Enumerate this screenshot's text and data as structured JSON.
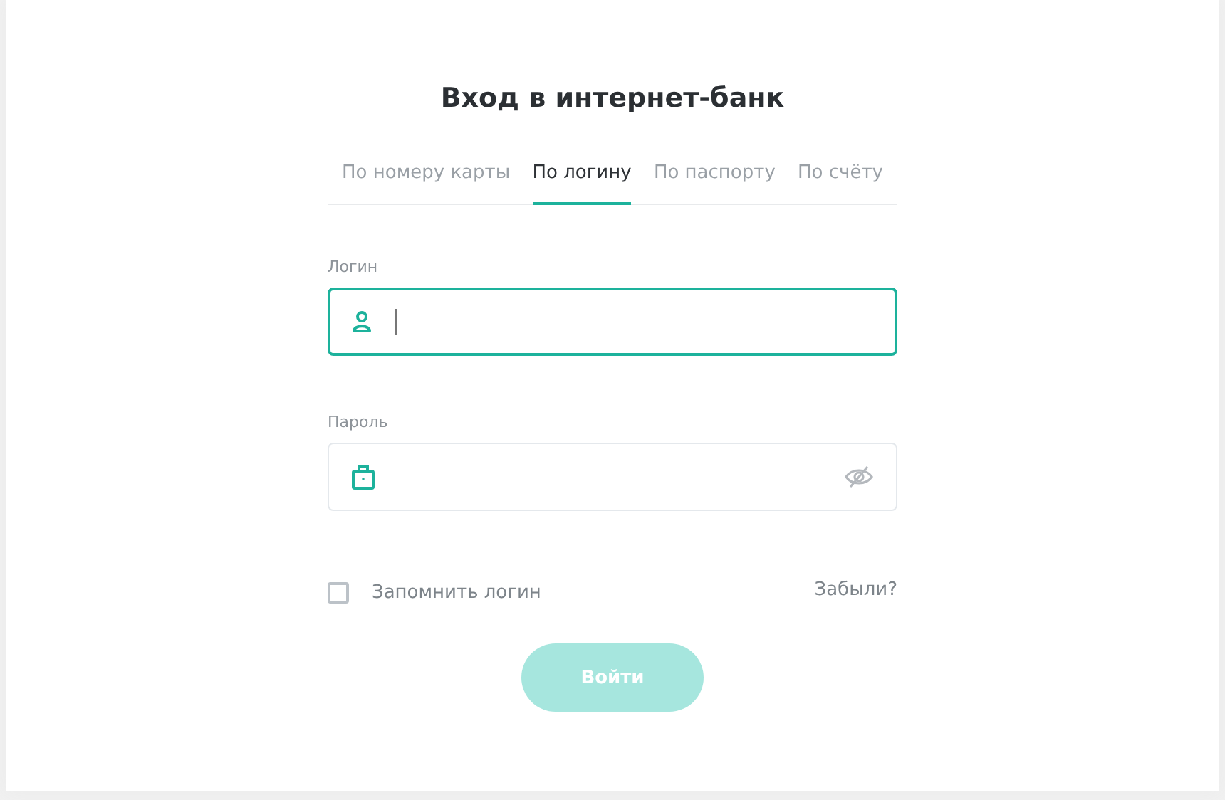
{
  "title": "Вход в интернет-банк",
  "tabs": [
    {
      "label": "По номеру карты",
      "selected": false
    },
    {
      "label": "По логину",
      "selected": true
    },
    {
      "label": "По паспорту",
      "selected": false
    },
    {
      "label": "По счёту",
      "selected": false
    }
  ],
  "fields": [
    {
      "kind": "login",
      "label": "Логин",
      "focused": true
    },
    {
      "kind": "password",
      "label": "Пароль",
      "focused": false
    }
  ],
  "remember": {
    "label": "Запомнить логин",
    "checked": false
  },
  "forgot": "Забыли?",
  "submit": {
    "label": "Войти",
    "disabled": true
  }
}
